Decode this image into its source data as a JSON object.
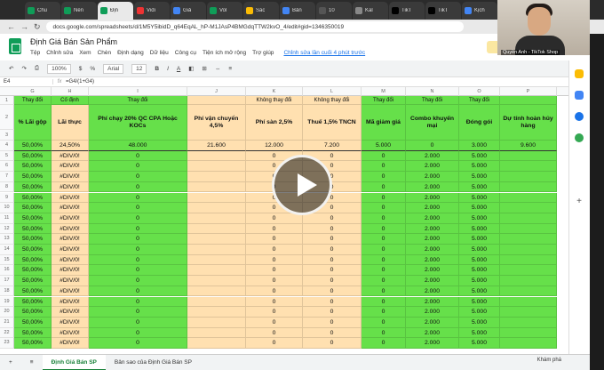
{
  "browser": {
    "tabs": [
      "Chu",
      "Nền",
      "Địn",
      "Vidi",
      "Giả",
      "Vol",
      "Sác",
      "Bản",
      "10 ",
      "Kal",
      "TikT",
      "TikT",
      "Kịch"
    ],
    "url": "docs.google.com/spreadsheets/d/1M5Y5ibidD_q64EqAL_hP-M1JAsP4BMGdqTTW2kvO_4/edit#gid=1346350019"
  },
  "webcam": {
    "caption": "Quyền Anh - TikTok Shop"
  },
  "sheet": {
    "title": "Định Giá Bán Sản Phẩm",
    "menus": [
      "Tệp",
      "Chỉnh sửa",
      "Xem",
      "Chèn",
      "Định dạng",
      "Dữ liệu",
      "Công cụ",
      "Tiện ích mở rộng",
      "Trợ giúp"
    ],
    "last_edit": "Chỉnh sửa lần cuối 4 phút trước",
    "toolbar": {
      "zoom": "100%",
      "currency": "$",
      "percent": "%",
      "font": "Arial",
      "font_size": "12",
      "bold": "B",
      "italic": "I",
      "underline": "A"
    },
    "cell_ref": "E4",
    "formula": "=G4/(1+G4)",
    "col_letters": [
      "G",
      "H",
      "I",
      "J",
      "K",
      "L",
      "M",
      "N",
      "O",
      "P"
    ],
    "row1": [
      "Thay đổi",
      "Cố định",
      "Thay đổi",
      "",
      "Không thay đổi",
      "Không thay đổi",
      "Thay đổi",
      "Thay đổi",
      "Thay đổi",
      ""
    ],
    "headers": [
      "% Lãi gộp",
      "Lãi thực",
      "Phí chạy 20% QC CPA Hoặc KOCs",
      "Phí vận chuyển 4,5%",
      "Phí sàn 2,5%",
      "Thuế 1,5% TNCN",
      "Mã giảm giá",
      "Combo khuyến mại",
      "Đóng gói",
      "Dự tính hoàn hủy hàng"
    ],
    "row4": [
      "50,00%",
      "24,50%",
      "48.000",
      "21.600",
      "12.000",
      "7.200",
      "5.000",
      "0",
      "3.000",
      "9.600"
    ],
    "rows_rest": [
      "50,00%",
      "#DIV/0!",
      "0",
      "",
      "0",
      "0",
      "0",
      "2.000",
      "5.000",
      ""
    ],
    "row_numbers": [
      "1",
      "2",
      "3",
      "4",
      "5",
      "6",
      "7",
      "8",
      "9",
      "10",
      "11",
      "12",
      "13",
      "14",
      "15",
      "16",
      "17",
      "18",
      "19",
      "20",
      "21",
      "22",
      "23"
    ],
    "sheet_tabs": [
      "Định Giá Bán SP",
      "Bản sao của Định Giá Bán SP"
    ],
    "explore": "Khám phá"
  }
}
